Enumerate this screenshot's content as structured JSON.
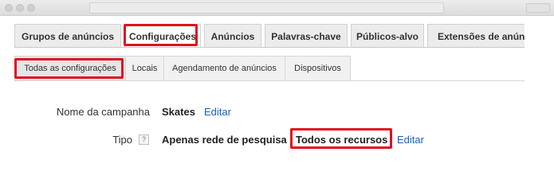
{
  "primary_tabs": [
    {
      "label": "Grupos de anúncios"
    },
    {
      "label": "Configurações",
      "active": true
    },
    {
      "label": "Anúncios"
    },
    {
      "label": "Palavras-chave"
    },
    {
      "label": "Públicos-alvo"
    },
    {
      "label": "Extensões de anúnci"
    }
  ],
  "secondary_tabs": [
    {
      "label": "Todas as configurações",
      "active": true
    },
    {
      "label": "Locais"
    },
    {
      "label": "Agendamento de anúncios"
    },
    {
      "label": "Dispositivos"
    }
  ],
  "settings": {
    "campaign_name_label": "Nome da campanha",
    "campaign_name_value": "Skates",
    "campaign_name_edit": "Editar",
    "type_label": "Tipo",
    "type_help": "?",
    "type_value": "Apenas rede de pesquisa",
    "type_subvalue": "Todos os recursos",
    "type_edit": "Editar"
  },
  "colors": {
    "highlight": "#e0101f",
    "link": "#1a5fc3"
  }
}
